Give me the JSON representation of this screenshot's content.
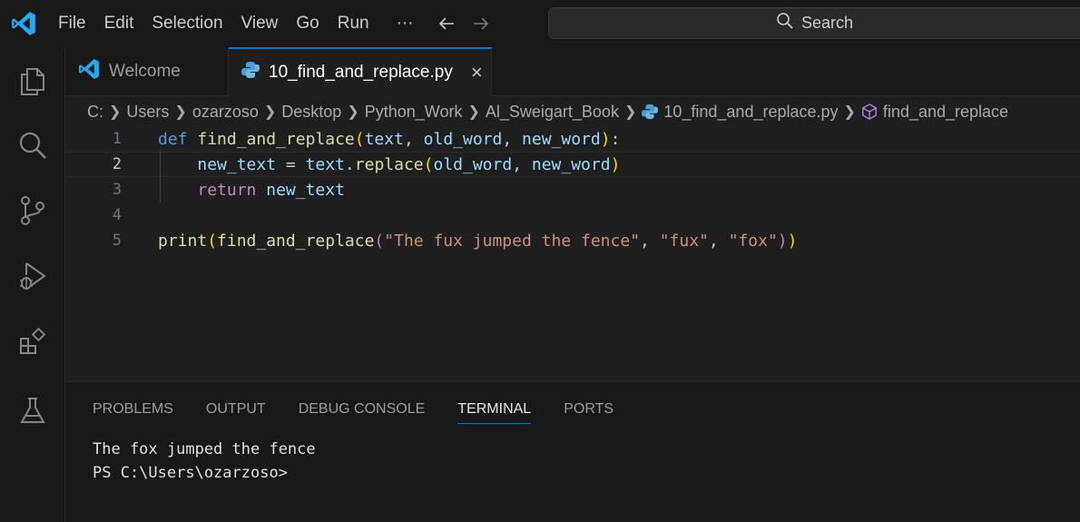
{
  "menu": [
    "File",
    "Edit",
    "Selection",
    "View",
    "Go",
    "Run"
  ],
  "menu_more": "···",
  "search": {
    "label": "Search"
  },
  "tabs": [
    {
      "label": "Welcome",
      "icon": "vscode-logo-icon",
      "active": false
    },
    {
      "label": "10_find_and_replace.py",
      "icon": "python-icon",
      "active": true
    }
  ],
  "tab_close": "×",
  "breadcrumb": [
    "C:",
    "Users",
    "ozarzoso",
    "Desktop",
    "Python_Work",
    "Al_Sweigart_Book",
    "10_find_and_replace.py",
    "find_and_replace"
  ],
  "editor": {
    "line_numbers": [
      "1",
      "2",
      "3",
      "4",
      "5"
    ],
    "current_line": 2,
    "lines": [
      [
        {
          "t": "def",
          "c": "kw-def"
        },
        {
          "t": " "
        },
        {
          "t": "find_and_replace",
          "c": "fn"
        },
        {
          "t": "(",
          "c": "p1"
        },
        {
          "t": "text",
          "c": "var"
        },
        {
          "t": ", "
        },
        {
          "t": "old_word",
          "c": "var"
        },
        {
          "t": ", "
        },
        {
          "t": "new_word",
          "c": "var"
        },
        {
          "t": ")",
          "c": "p1"
        },
        {
          "t": ":"
        }
      ],
      [
        {
          "t": "    "
        },
        {
          "t": "new_text",
          "c": "var"
        },
        {
          "t": " = "
        },
        {
          "t": "text",
          "c": "var"
        },
        {
          "t": "."
        },
        {
          "t": "replace",
          "c": "fn"
        },
        {
          "t": "(",
          "c": "p1"
        },
        {
          "t": "old_word",
          "c": "var"
        },
        {
          "t": ", "
        },
        {
          "t": "new_word",
          "c": "var"
        },
        {
          "t": ")",
          "c": "p1"
        }
      ],
      [
        {
          "t": "    "
        },
        {
          "t": "return",
          "c": "kw-ret"
        },
        {
          "t": " "
        },
        {
          "t": "new_text",
          "c": "var"
        }
      ],
      [],
      [
        {
          "t": "print",
          "c": "fn"
        },
        {
          "t": "(",
          "c": "p1"
        },
        {
          "t": "find_and_replace",
          "c": "fn"
        },
        {
          "t": "(",
          "c": "p2"
        },
        {
          "t": "\"The fux jumped the fence\"",
          "c": "str"
        },
        {
          "t": ", "
        },
        {
          "t": "\"fux\"",
          "c": "str"
        },
        {
          "t": ", "
        },
        {
          "t": "\"fox\"",
          "c": "str"
        },
        {
          "t": ")",
          "c": "p2"
        },
        {
          "t": ")",
          "c": "p1"
        }
      ]
    ]
  },
  "panel": {
    "tabs": [
      "PROBLEMS",
      "OUTPUT",
      "DEBUG CONSOLE",
      "TERMINAL",
      "PORTS"
    ],
    "active_tab": "TERMINAL",
    "terminal_lines": [
      "The fox jumped the fence",
      "PS C:\\Users\\ozarzoso>"
    ]
  },
  "colors": {
    "accent": "#0078d4",
    "background": "#1f1f1f",
    "chrome": "#181818"
  }
}
